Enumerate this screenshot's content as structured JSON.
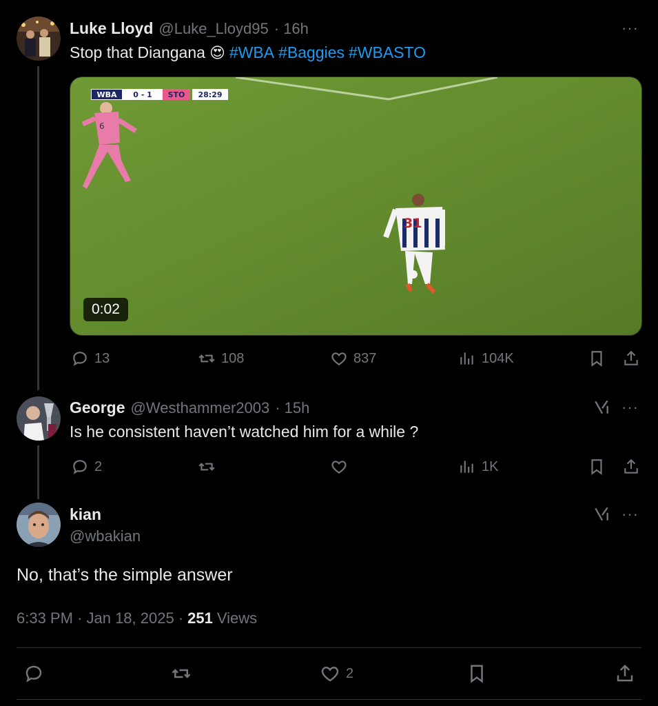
{
  "tweet1": {
    "name": "Luke Lloyd",
    "handle": "@Luke_Lloyd95",
    "time": "· 16h",
    "text": "Stop that Diangana",
    "emoji": "😍",
    "hashtags": [
      "#WBA",
      "#Baggies",
      "#WBASTO"
    ],
    "video": {
      "scorebug_home": "WBA",
      "scorebug_score": "0 - 1",
      "scorebug_away": "STO",
      "scorebug_clock": "28:29",
      "player_number": "31",
      "duration": "0:02"
    },
    "replies": "13",
    "reposts": "108",
    "likes": "837",
    "views": "104K"
  },
  "tweet2": {
    "name": "George",
    "handle": "@Westhammer2003",
    "time": "· 15h",
    "text": "Is he consistent haven’t watched him for a while ?",
    "replies": "2",
    "reposts": "",
    "likes": "",
    "views": "1K"
  },
  "tweet3": {
    "name": "kian",
    "handle": "@wbakian",
    "text": "No, that’s the simple answer",
    "time": "6:33 PM · Jan 18, 2025 ·",
    "views_count": "251",
    "views_label": "Views",
    "likes": "2"
  },
  "more_label": "···",
  "colors": {
    "accent": "#1d9bf0",
    "muted": "#71767b",
    "text": "#e7e9ea",
    "background": "#000000"
  }
}
